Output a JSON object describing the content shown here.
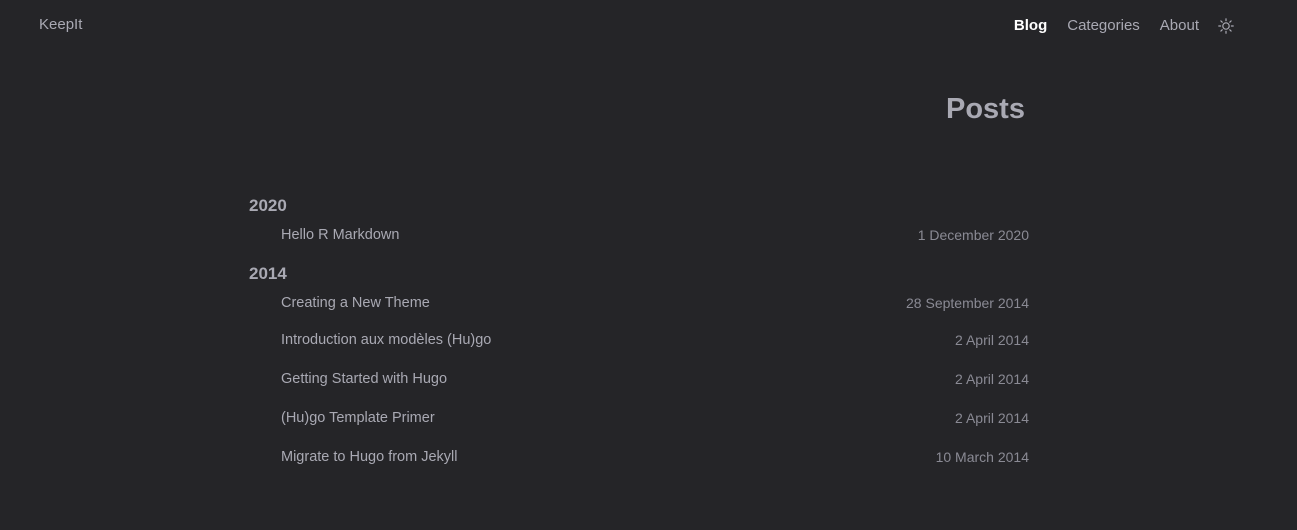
{
  "site": {
    "title": "KeepIt"
  },
  "nav": {
    "items": [
      {
        "label": "Blog",
        "active": true
      },
      {
        "label": "Categories",
        "active": false
      },
      {
        "label": "About",
        "active": false
      }
    ],
    "theme_toggle_icon": "sun-icon"
  },
  "main": {
    "title": "Posts",
    "years": [
      {
        "year": "2020",
        "posts": [
          {
            "title": "Hello R Markdown",
            "date": "1 December 2020"
          }
        ]
      },
      {
        "year": "2014",
        "posts": [
          {
            "title": "Creating a New Theme",
            "date": "28 September 2014"
          },
          {
            "title": "Introduction aux modèles (Hu)go",
            "date": "2 April 2014"
          },
          {
            "title": "Getting Started with Hugo",
            "date": "2 April 2014"
          },
          {
            "title": "(Hu)go Template Primer",
            "date": "2 April 2014"
          },
          {
            "title": "Migrate to Hugo from Jekyll",
            "date": "10 March 2014"
          }
        ]
      }
    ]
  },
  "colors": {
    "background": "#252528",
    "text": "#a9a9b3",
    "active_nav": "#ffffff"
  }
}
